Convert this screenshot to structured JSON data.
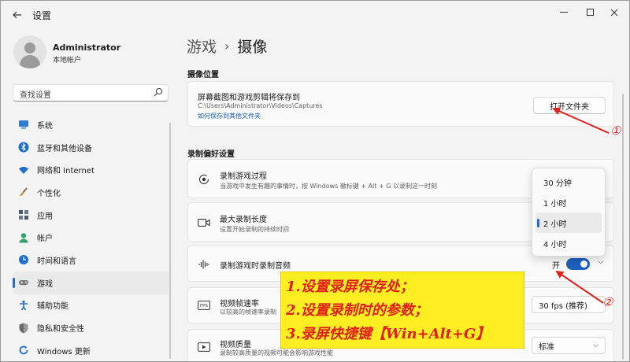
{
  "window": {
    "title": "设置",
    "back_icon": "back-arrow-icon"
  },
  "user": {
    "name": "Administrator",
    "type": "本地帐户"
  },
  "search": {
    "placeholder": "查找设置"
  },
  "nav": [
    {
      "label": "系统",
      "icon": "system-icon",
      "color": "#2f7dd1"
    },
    {
      "label": "蓝牙和其他设备",
      "icon": "bluetooth-icon",
      "color": "#1f6fd0"
    },
    {
      "label": "网络和 Internet",
      "icon": "wifi-icon",
      "color": "#1f6fd0"
    },
    {
      "label": "个性化",
      "icon": "brush-icon",
      "color": "#d08a2f"
    },
    {
      "label": "应用",
      "icon": "apps-icon",
      "color": "#4a5a6a"
    },
    {
      "label": "帐户",
      "icon": "account-icon",
      "color": "#2fa36b"
    },
    {
      "label": "时间和语言",
      "icon": "globe-clock-icon",
      "color": "#1f6fd0"
    },
    {
      "label": "游戏",
      "icon": "gamepad-icon",
      "color": "#6b6b6b",
      "active": true
    },
    {
      "label": "辅助功能",
      "icon": "accessibility-icon",
      "color": "#1f6fd0"
    },
    {
      "label": "隐私和安全性",
      "icon": "shield-icon",
      "color": "#6b6b6b"
    },
    {
      "label": "Windows 更新",
      "icon": "update-icon",
      "color": "#1f6fd0"
    }
  ],
  "breadcrumb": {
    "parent": "游戏",
    "separator": "›",
    "current": "摄像"
  },
  "capture_location": {
    "section_title": "摄像位置",
    "title": "屏幕截图和游戏剪辑将保存到",
    "path": "C:\\Users\\Administrator\\Videos\\Captures",
    "link": "如何保存到其他文件夹",
    "button": "打开文件夹"
  },
  "recording_prefs": {
    "section_title": "录制偏好设置",
    "record_game": {
      "title": "录制游戏过程",
      "sub": "当游戏中发生有趣的事情时，按 Windows 徽标键 + Alt + G 以录制这一时刻"
    },
    "max_length": {
      "title": "最大录制长度",
      "sub": "设置开始录制的持续时间"
    },
    "record_audio": {
      "title": "录制游戏时录制音频",
      "toggle_label": "开",
      "toggle_on": true
    },
    "frame_rate": {
      "title": "视频帧速率",
      "sub": "以较高的帧速率录制",
      "value": "30 fps (推荐)"
    },
    "video_quality": {
      "title": "视频质量",
      "sub": "录制较高质量的视频可能会影响游戏性能",
      "value": "标准"
    }
  },
  "length_dropdown": {
    "options": [
      "30 分钟",
      "1 小时",
      "2 小时",
      "4 小时"
    ],
    "selected_index": 2
  },
  "annotation": {
    "lines": [
      "1.设置录屏保存处；",
      "2.设置录制时的参数；",
      "3.录屏快捷键【Win+Alt+G】"
    ],
    "marker_1": "①",
    "marker_2": "②",
    "color": "#e0201b",
    "background": "#ffee22"
  },
  "colors": {
    "accent": "#1f6fd0",
    "toggle": "#1f5fbf"
  }
}
